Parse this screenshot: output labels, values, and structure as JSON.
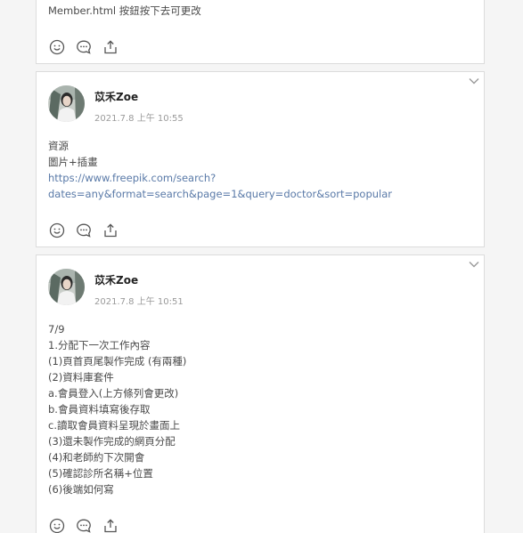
{
  "posts": [
    {
      "body_lines": [
        "Member.html 按鈕按下去可更改"
      ]
    },
    {
      "author": "苡禾Zoe",
      "time": "2021.7.8 上午 10:55",
      "body_lines": [
        "資源",
        "圖片+插畫",
        "https://www.freepik.com/search?",
        "dates=any&format=search&page=1&query=doctor&sort=popular"
      ]
    },
    {
      "author": "苡禾Zoe",
      "time": "2021.7.8 上午 10:51",
      "body_lines": [
        "7/9",
        "1.分配下一次工作內容",
        "(1)頁首頁尾製作完成 (有兩種)",
        "(2)資料庫套件",
        "a.會員登入(上方條列會更改)",
        "b.會員資料填寫後存取",
        "c.讀取會員資料呈現於畫面上",
        "(3)還未製作完成的網頁分配",
        "(4)和老師約下次開會",
        "(5)確認診所名稱+位置",
        "(6)後端如何寫"
      ]
    }
  ],
  "icons": {
    "react": "smiley-icon",
    "comment": "comment-icon",
    "share": "share-icon",
    "menu": "chevron-down-icon"
  },
  "colors": {
    "link": "#5a7aa8",
    "background": "#f5f5f5",
    "card_border": "#dcdcdc"
  }
}
